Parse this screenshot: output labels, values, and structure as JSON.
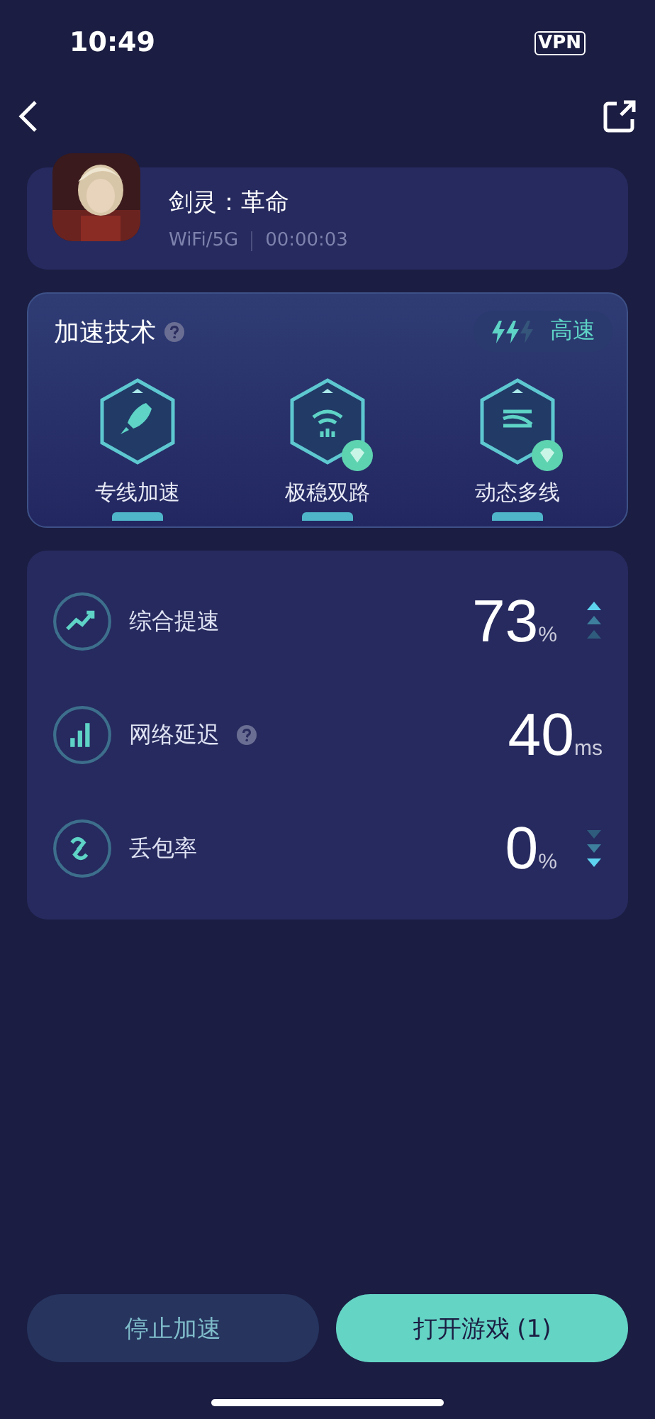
{
  "status_bar": {
    "time": "10:49",
    "vpn": "VPN"
  },
  "game": {
    "title": "剑灵：革命",
    "network": "WiFi/5G",
    "elapsed": "00:00:03"
  },
  "tech": {
    "title": "加速技术",
    "speed": {
      "label": "高速",
      "level": 0.67
    },
    "items": [
      {
        "label": "专线加速",
        "kind": "rocket",
        "premium": false
      },
      {
        "label": "极稳双路",
        "kind": "dual",
        "premium": true
      },
      {
        "label": "动态多线",
        "kind": "multi",
        "premium": true
      }
    ]
  },
  "stats": [
    {
      "kind": "speed",
      "label": "综合提速",
      "help": false,
      "value": "73",
      "unit": "%",
      "arrows_up": true,
      "arrows_down": false
    },
    {
      "kind": "latency",
      "label": "网络延迟",
      "help": true,
      "value": "40",
      "unit": "ms",
      "arrows_up": false,
      "arrows_down": false
    },
    {
      "kind": "loss",
      "label": "丢包率",
      "help": false,
      "value": "0",
      "unit": "%",
      "arrows_up": false,
      "arrows_down": true
    }
  ],
  "buttons": {
    "stop": "停止加速",
    "open": "打开游戏 (1)"
  }
}
